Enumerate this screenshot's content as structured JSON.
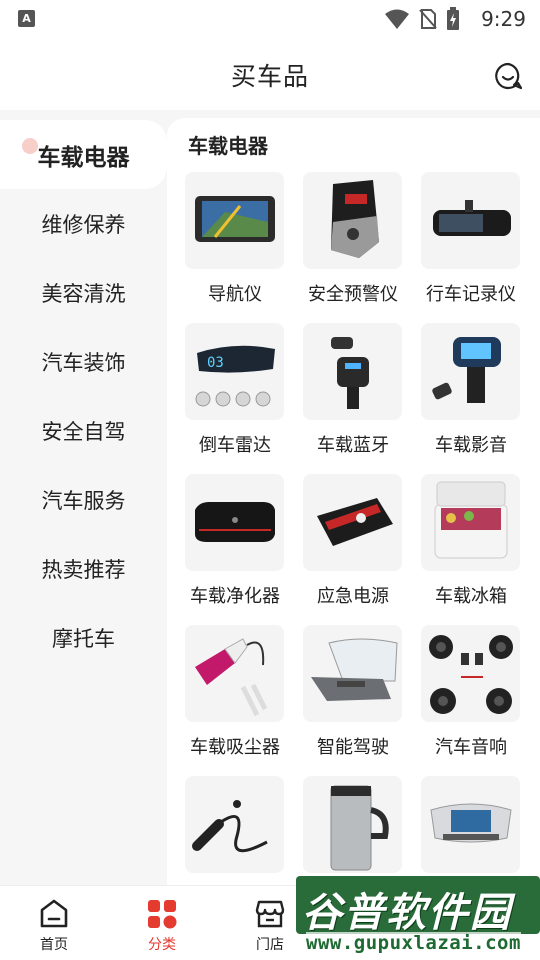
{
  "status_bar": {
    "app_badge": "A",
    "time": "9:29"
  },
  "header": {
    "title": "买车品",
    "chat_icon": "chat-bubble-icon"
  },
  "sidebar": {
    "items": [
      {
        "label": "车载电器",
        "active": true
      },
      {
        "label": "维修保养",
        "active": false
      },
      {
        "label": "美容清洗",
        "active": false
      },
      {
        "label": "汽车装饰",
        "active": false
      },
      {
        "label": "安全自驾",
        "active": false
      },
      {
        "label": "汽车服务",
        "active": false
      },
      {
        "label": "热卖推荐",
        "active": false
      },
      {
        "label": "摩托车",
        "active": false
      }
    ]
  },
  "content": {
    "section_title": "车载电器",
    "products": [
      {
        "label": "导航仪",
        "icon": "gps-navigator"
      },
      {
        "label": "安全预警仪",
        "icon": "radar-detector"
      },
      {
        "label": "行车记录仪",
        "icon": "mirror-dashcam"
      },
      {
        "label": "倒车雷达",
        "icon": "parking-sensor"
      },
      {
        "label": "车载蓝牙",
        "icon": "bluetooth-transmitter"
      },
      {
        "label": "车载影音",
        "icon": "fm-transmitter"
      },
      {
        "label": "车载净化器",
        "icon": "air-purifier"
      },
      {
        "label": "应急电源",
        "icon": "jump-starter"
      },
      {
        "label": "车载冰箱",
        "icon": "car-fridge"
      },
      {
        "label": "车载吸尘器",
        "icon": "vacuum-cleaner"
      },
      {
        "label": "智能驾驶",
        "icon": "hud-display"
      },
      {
        "label": "汽车音响",
        "icon": "car-speakers"
      },
      {
        "label": "",
        "icon": "charger-cable"
      },
      {
        "label": "",
        "icon": "heated-mug"
      },
      {
        "label": "",
        "icon": "dash-screen"
      }
    ]
  },
  "tabbar": {
    "tabs": [
      {
        "label": "首页",
        "icon": "home-icon",
        "active": false
      },
      {
        "label": "分类",
        "icon": "category-grid-icon",
        "active": true
      },
      {
        "label": "门店",
        "icon": "store-icon",
        "active": false
      }
    ]
  },
  "watermark": {
    "title": "谷普软件园",
    "url": "www.gupuxlazai.com"
  },
  "colors": {
    "accent": "#e53a30",
    "sidebar_bg": "#f6f6f6",
    "watermark_green": "#185f28"
  }
}
